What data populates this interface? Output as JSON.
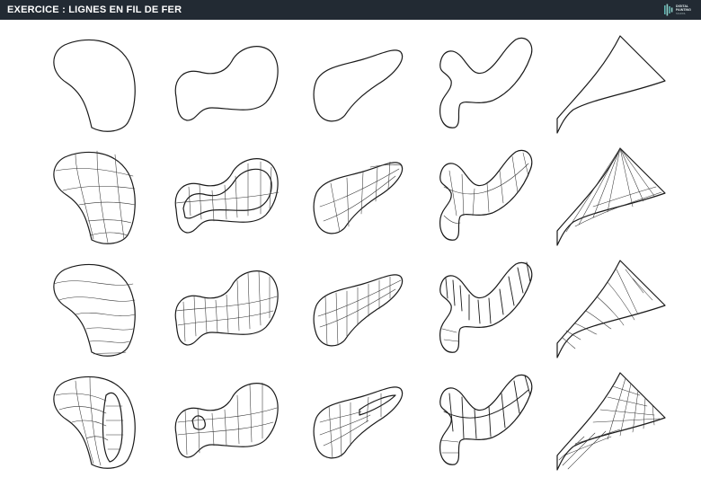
{
  "header": {
    "title": "EXERCICE : LIGNES EN FIL DE FER",
    "logo_text": "DIGITAL PAINTING",
    "logo_subtext": "SCHOOL",
    "logo_icon": "brush-stroke-icon"
  },
  "sheet": {
    "rows": 4,
    "columns": 5
  }
}
